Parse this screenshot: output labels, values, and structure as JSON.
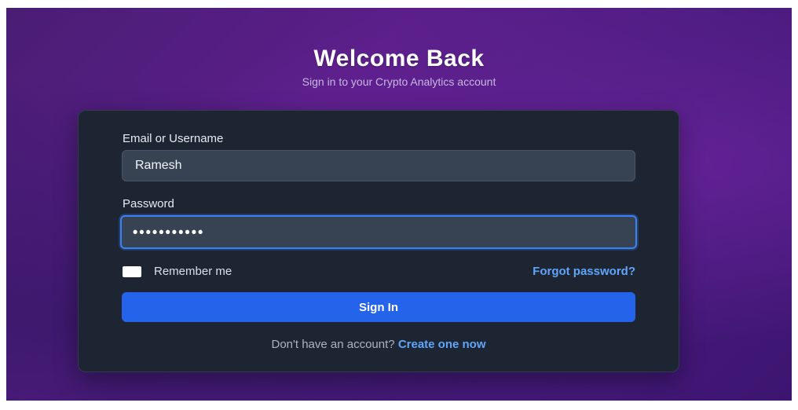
{
  "header": {
    "title": "Welcome Back",
    "subtitle": "Sign in to your Crypto Analytics account"
  },
  "form": {
    "email_label": "Email or Username",
    "email_value": "Ramesh",
    "password_label": "Password",
    "password_value": "•••••••••••",
    "remember_label": "Remember me",
    "remember_checked": false,
    "forgot_label": "Forgot password?",
    "submit_label": "Sign In"
  },
  "footer": {
    "prompt": "Don't have an account?",
    "link_label": "Create one now"
  },
  "colors": {
    "background": "#4a1d74",
    "card": "#1d2533",
    "input": "#374353",
    "accent": "#2563eb",
    "link": "#60a5fa"
  }
}
